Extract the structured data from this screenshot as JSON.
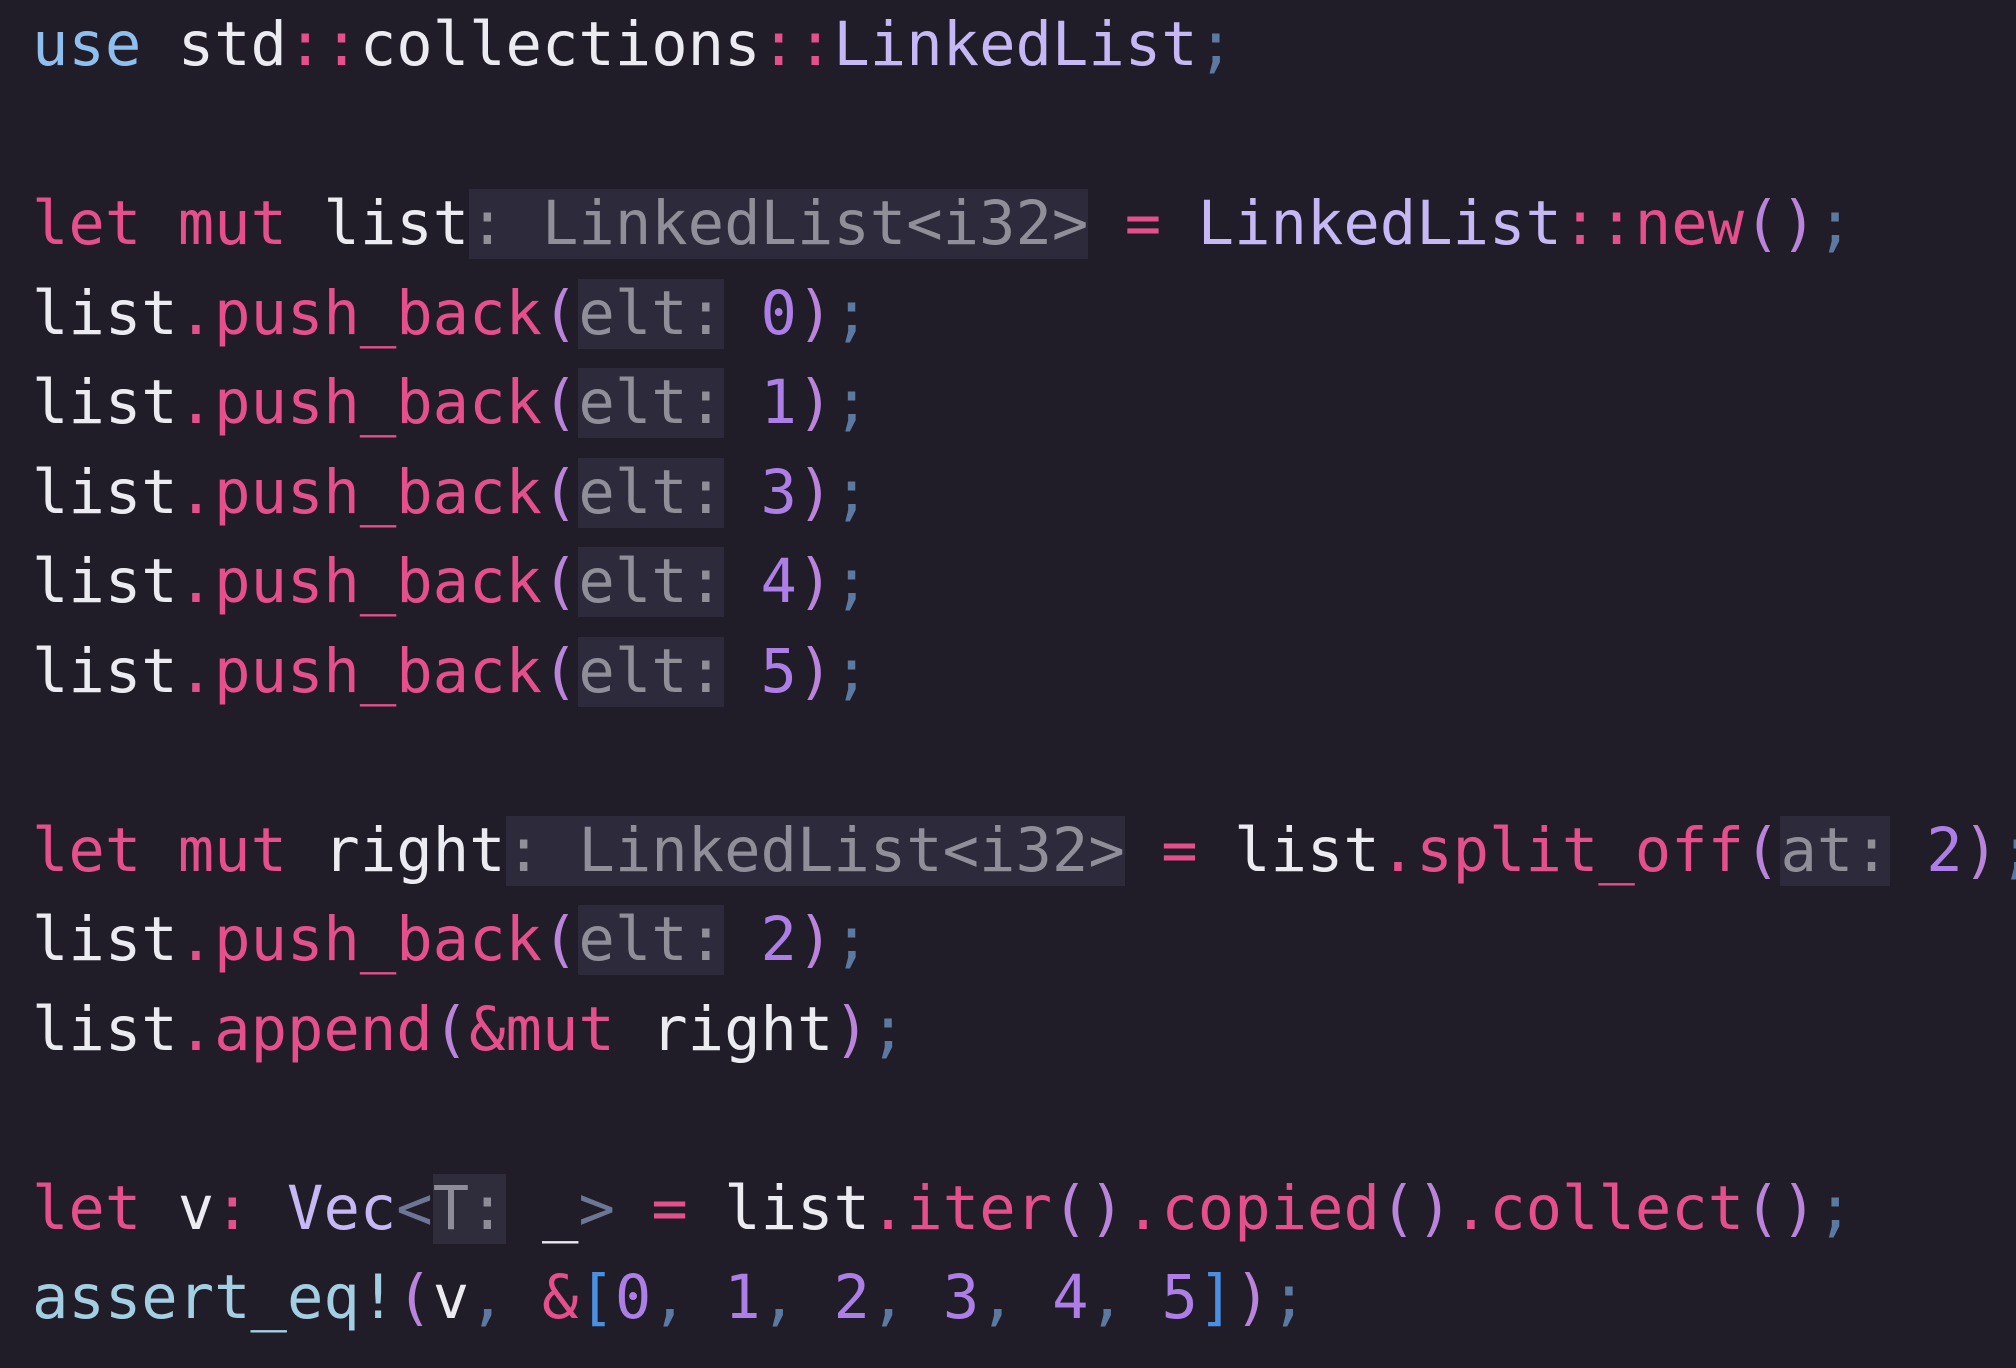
{
  "editor": {
    "language": "rust",
    "theme_colors": {
      "background": "#201d29",
      "keyword": "#e44f8c",
      "keyword_use": "#8fbfef",
      "type": "#c6b8f4",
      "number": "#ad7fe6",
      "punctuation": "#5c7aa1",
      "inlay_hint_bg": "#2d2b3b",
      "inlay_hint_fg": "#908e98",
      "text": "#ecebf2"
    },
    "lines": [
      {
        "tokens": [
          {
            "t": "use",
            "c": "keyword_blue"
          },
          {
            "t": " std",
            "c": "default"
          },
          {
            "t": "::",
            "c": "keyword"
          },
          {
            "t": "collections",
            "c": "default"
          },
          {
            "t": "::",
            "c": "keyword"
          },
          {
            "t": "LinkedList",
            "c": "type"
          },
          {
            "t": ";",
            "c": "punct"
          }
        ]
      },
      {
        "tokens": []
      },
      {
        "tokens": [
          {
            "t": "let",
            "c": "keyword"
          },
          {
            "t": " ",
            "c": "default"
          },
          {
            "t": "mut",
            "c": "keyword"
          },
          {
            "t": " list",
            "c": "default"
          },
          {
            "t": ": LinkedList<i32>",
            "c": "hint"
          },
          {
            "t": " ",
            "c": "default"
          },
          {
            "t": "=",
            "c": "keyword"
          },
          {
            "t": " ",
            "c": "default"
          },
          {
            "t": "LinkedList",
            "c": "type"
          },
          {
            "t": "::",
            "c": "keyword"
          },
          {
            "t": "new",
            "c": "func"
          },
          {
            "t": "()",
            "c": "paren"
          },
          {
            "t": ";",
            "c": "punct"
          }
        ]
      },
      {
        "tokens": [
          {
            "t": "list",
            "c": "default"
          },
          {
            "t": ".",
            "c": "keyword"
          },
          {
            "t": "push_back",
            "c": "func"
          },
          {
            "t": "(",
            "c": "paren"
          },
          {
            "t": "elt:",
            "c": "hint"
          },
          {
            "t": " ",
            "c": "default"
          },
          {
            "t": "0",
            "c": "number"
          },
          {
            "t": ")",
            "c": "paren"
          },
          {
            "t": ";",
            "c": "punct"
          }
        ]
      },
      {
        "tokens": [
          {
            "t": "list",
            "c": "default"
          },
          {
            "t": ".",
            "c": "keyword"
          },
          {
            "t": "push_back",
            "c": "func"
          },
          {
            "t": "(",
            "c": "paren"
          },
          {
            "t": "elt:",
            "c": "hint"
          },
          {
            "t": " ",
            "c": "default"
          },
          {
            "t": "1",
            "c": "number"
          },
          {
            "t": ")",
            "c": "paren"
          },
          {
            "t": ";",
            "c": "punct"
          }
        ]
      },
      {
        "tokens": [
          {
            "t": "list",
            "c": "default"
          },
          {
            "t": ".",
            "c": "keyword"
          },
          {
            "t": "push_back",
            "c": "func"
          },
          {
            "t": "(",
            "c": "paren"
          },
          {
            "t": "elt:",
            "c": "hint"
          },
          {
            "t": " ",
            "c": "default"
          },
          {
            "t": "3",
            "c": "number"
          },
          {
            "t": ")",
            "c": "paren"
          },
          {
            "t": ";",
            "c": "punct"
          }
        ]
      },
      {
        "tokens": [
          {
            "t": "list",
            "c": "default"
          },
          {
            "t": ".",
            "c": "keyword"
          },
          {
            "t": "push_back",
            "c": "func"
          },
          {
            "t": "(",
            "c": "paren"
          },
          {
            "t": "elt:",
            "c": "hint"
          },
          {
            "t": " ",
            "c": "default"
          },
          {
            "t": "4",
            "c": "number"
          },
          {
            "t": ")",
            "c": "paren"
          },
          {
            "t": ";",
            "c": "punct"
          }
        ]
      },
      {
        "tokens": [
          {
            "t": "list",
            "c": "default"
          },
          {
            "t": ".",
            "c": "keyword"
          },
          {
            "t": "push_back",
            "c": "func"
          },
          {
            "t": "(",
            "c": "paren"
          },
          {
            "t": "elt:",
            "c": "hint"
          },
          {
            "t": " ",
            "c": "default"
          },
          {
            "t": "5",
            "c": "number"
          },
          {
            "t": ")",
            "c": "paren"
          },
          {
            "t": ";",
            "c": "punct"
          }
        ]
      },
      {
        "tokens": []
      },
      {
        "tokens": [
          {
            "t": "let",
            "c": "keyword"
          },
          {
            "t": " ",
            "c": "default"
          },
          {
            "t": "mut",
            "c": "keyword"
          },
          {
            "t": " right",
            "c": "default"
          },
          {
            "t": ": LinkedList<i32>",
            "c": "hint"
          },
          {
            "t": " ",
            "c": "default"
          },
          {
            "t": "=",
            "c": "keyword"
          },
          {
            "t": " list",
            "c": "default"
          },
          {
            "t": ".",
            "c": "keyword"
          },
          {
            "t": "split_off",
            "c": "func"
          },
          {
            "t": "(",
            "c": "paren"
          },
          {
            "t": "at:",
            "c": "hint"
          },
          {
            "t": " ",
            "c": "default"
          },
          {
            "t": "2",
            "c": "number"
          },
          {
            "t": ")",
            "c": "paren"
          },
          {
            "t": ";",
            "c": "punct"
          }
        ]
      },
      {
        "tokens": [
          {
            "t": "list",
            "c": "default"
          },
          {
            "t": ".",
            "c": "keyword"
          },
          {
            "t": "push_back",
            "c": "func"
          },
          {
            "t": "(",
            "c": "paren"
          },
          {
            "t": "elt:",
            "c": "hint"
          },
          {
            "t": " ",
            "c": "default"
          },
          {
            "t": "2",
            "c": "number"
          },
          {
            "t": ")",
            "c": "paren"
          },
          {
            "t": ";",
            "c": "punct"
          }
        ]
      },
      {
        "tokens": [
          {
            "t": "list",
            "c": "default"
          },
          {
            "t": ".",
            "c": "keyword"
          },
          {
            "t": "append",
            "c": "func"
          },
          {
            "t": "(",
            "c": "paren"
          },
          {
            "t": "&mut",
            "c": "keyword"
          },
          {
            "t": " right",
            "c": "default"
          },
          {
            "t": ")",
            "c": "paren"
          },
          {
            "t": ";",
            "c": "punct"
          }
        ]
      },
      {
        "tokens": []
      },
      {
        "tokens": [
          {
            "t": "let",
            "c": "keyword"
          },
          {
            "t": " v",
            "c": "default"
          },
          {
            "t": ":",
            "c": "keyword"
          },
          {
            "t": " ",
            "c": "default"
          },
          {
            "t": "Vec",
            "c": "type"
          },
          {
            "t": "<",
            "c": "angle"
          },
          {
            "t": "T:",
            "c": "hint-soft"
          },
          {
            "t": " ",
            "c": "default"
          },
          {
            "t": "_",
            "c": "default"
          },
          {
            "t": ">",
            "c": "angle"
          },
          {
            "t": " ",
            "c": "default"
          },
          {
            "t": "=",
            "c": "keyword"
          },
          {
            "t": " list",
            "c": "default"
          },
          {
            "t": ".",
            "c": "keyword"
          },
          {
            "t": "iter",
            "c": "func"
          },
          {
            "t": "()",
            "c": "paren"
          },
          {
            "t": ".",
            "c": "keyword"
          },
          {
            "t": "copied",
            "c": "func"
          },
          {
            "t": "()",
            "c": "paren"
          },
          {
            "t": ".",
            "c": "keyword"
          },
          {
            "t": "collect",
            "c": "func"
          },
          {
            "t": "()",
            "c": "paren"
          },
          {
            "t": ";",
            "c": "punct"
          }
        ]
      },
      {
        "tokens": [
          {
            "t": "assert_eq!",
            "c": "macro"
          },
          {
            "t": "(",
            "c": "paren"
          },
          {
            "t": "v",
            "c": "default"
          },
          {
            "t": ",",
            "c": "punct"
          },
          {
            "t": " ",
            "c": "default"
          },
          {
            "t": "&",
            "c": "keyword"
          },
          {
            "t": "[",
            "c": "bracket"
          },
          {
            "t": "0",
            "c": "number"
          },
          {
            "t": ",",
            "c": "punct"
          },
          {
            "t": " ",
            "c": "default"
          },
          {
            "t": "1",
            "c": "number"
          },
          {
            "t": ",",
            "c": "punct"
          },
          {
            "t": " ",
            "c": "default"
          },
          {
            "t": "2",
            "c": "number"
          },
          {
            "t": ",",
            "c": "punct"
          },
          {
            "t": " ",
            "c": "default"
          },
          {
            "t": "3",
            "c": "number"
          },
          {
            "t": ",",
            "c": "punct"
          },
          {
            "t": " ",
            "c": "default"
          },
          {
            "t": "4",
            "c": "number"
          },
          {
            "t": ",",
            "c": "punct"
          },
          {
            "t": " ",
            "c": "default"
          },
          {
            "t": "5",
            "c": "number"
          },
          {
            "t": "]",
            "c": "bracket"
          },
          {
            "t": ")",
            "c": "paren"
          },
          {
            "t": ";",
            "c": "punct"
          }
        ]
      }
    ]
  }
}
